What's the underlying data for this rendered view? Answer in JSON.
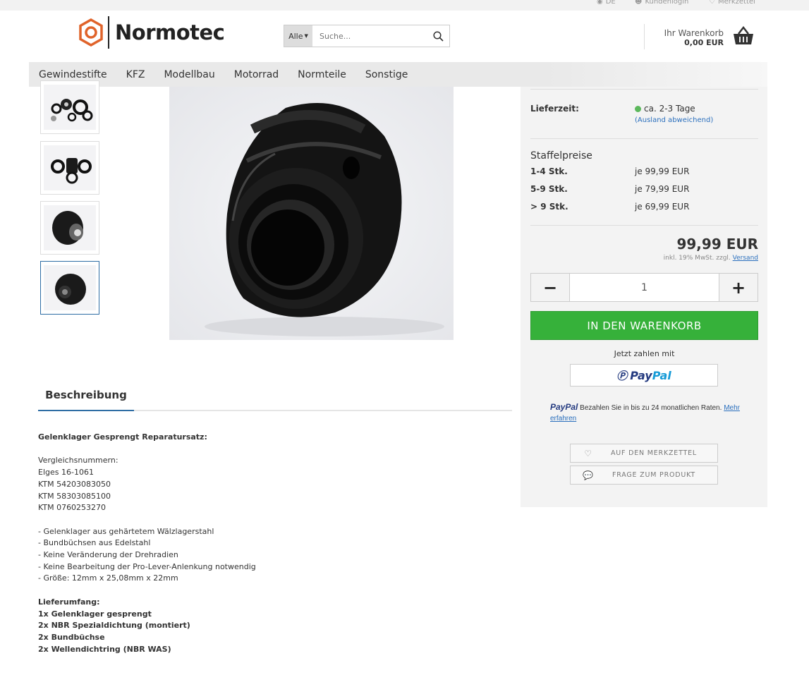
{
  "topbar": {
    "language": "DE",
    "login": "Kundenlogin",
    "wishlist": "Merkzettel"
  },
  "header": {
    "logo_text": "Normotec",
    "search_category": "Alle",
    "search_placeholder": "Suche...",
    "cart_label": "Ihr Warenkorb",
    "cart_total": "0,00 EUR"
  },
  "nav": {
    "items": [
      "Gewindestifte",
      "KFZ",
      "Modellbau",
      "Motorrad",
      "Normteile",
      "Sonstige"
    ]
  },
  "gallery": {
    "thumbnail_count": 4,
    "active_index": 3
  },
  "product": {
    "delivery_label": "Lieferzeit:",
    "delivery_value": "ca. 2-3 Tage",
    "delivery_note": "(Ausland abweichend)",
    "delivery_status_color": "#5cb85c",
    "staffel_title": "Staffelpreise",
    "staffel": [
      {
        "qty": "1-4 Stk.",
        "price": "je 99,99 EUR"
      },
      {
        "qty": "5-9 Stk.",
        "price": "je 79,99 EUR"
      },
      {
        "qty": "> 9 Stk.",
        "price": "je 69,99 EUR"
      }
    ],
    "price": "99,99 EUR",
    "tax_note": "inkl. 19% MwSt. zzgl.",
    "shipping_link": "Versand",
    "quantity": "1",
    "add_to_cart": "IN DEN WARENKORB",
    "pay_now": "Jetzt zahlen mit",
    "paypal_pay": "Pay",
    "paypal_pal": "Pal",
    "paypal_credit_logo": "PayPal",
    "paypal_credit_text": "Bezahlen Sie in bis zu 24 monatlichen Raten.",
    "paypal_credit_link": "Mehr erfahren",
    "wishlist_button": "AUF DEN MERKZETTEL",
    "question_button": "FRAGE ZUM PRODUKT"
  },
  "description": {
    "tab": "Beschreibung",
    "title": "Gelenklager Gesprengt Reparatursatz:",
    "compare_label": "Vergleichsnummern:",
    "compare_numbers": [
      "Elges 16-1061",
      "KTM 54203083050",
      "KTM 58303085100",
      "KTM 0760253270"
    ],
    "features": [
      "- Gelenklager aus gehärtetem Wälzlagerstahl",
      "- Bundbüchsen aus Edelstahl",
      "- Keine Veränderung der Drehradien",
      "- Keine Bearbeitung der Pro-Lever-Anlenkung notwendig",
      "- Größe: 12mm x 25,08mm x 22mm"
    ],
    "scope_label": "Lieferumfang:",
    "scope_items": [
      "1x Gelenklager gesprengt",
      "2x NBR Spezialdichtung (montiert)",
      "2x Bundbüchse",
      "2x Wellendichtring (NBR WAS)"
    ]
  },
  "colors": {
    "accent": "#2e6da4",
    "cart_green": "#36b13a",
    "logo_orange": "#e0632a"
  }
}
